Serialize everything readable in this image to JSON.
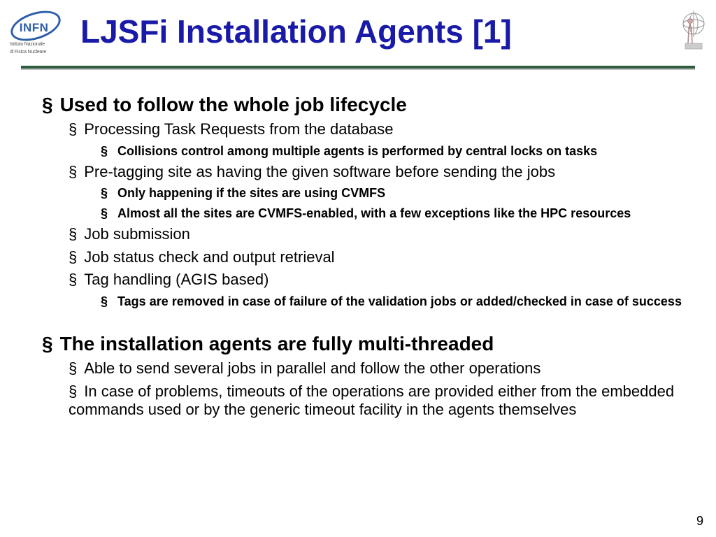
{
  "logo_left": {
    "acronym": "INFN",
    "sub1": "Istituto Nazionale",
    "sub2": "di Fisica Nucleare"
  },
  "title": "LJSFi Installation Agents [1]",
  "bullets": {
    "b1": "Used to follow the whole job lifecycle",
    "b1_1": "Processing Task Requests from the database",
    "b1_1_1": "Collisions control among multiple agents is performed by central locks on tasks",
    "b1_2": "Pre-tagging site as having the given software before sending the jobs",
    "b1_2_1": "Only happening if the sites are using CVMFS",
    "b1_2_2": "Almost all the sites are CVMFS-enabled, with a few exceptions like the HPC resources",
    "b1_3": "Job submission",
    "b1_4": "Job status check and output retrieval",
    "b1_5": "Tag handling (AGIS based)",
    "b1_5_1": "Tags are removed in case of failure of the validation jobs or added/checked in case of success",
    "b2": "The installation agents are fully multi-threaded",
    "b2_1": "Able to send several jobs in parallel and follow the other operations",
    "b2_2": "In case of problems, timeouts of the operations are provided either from the embedded commands used or by the generic timeout facility in the agents themselves"
  },
  "page_number": "9"
}
